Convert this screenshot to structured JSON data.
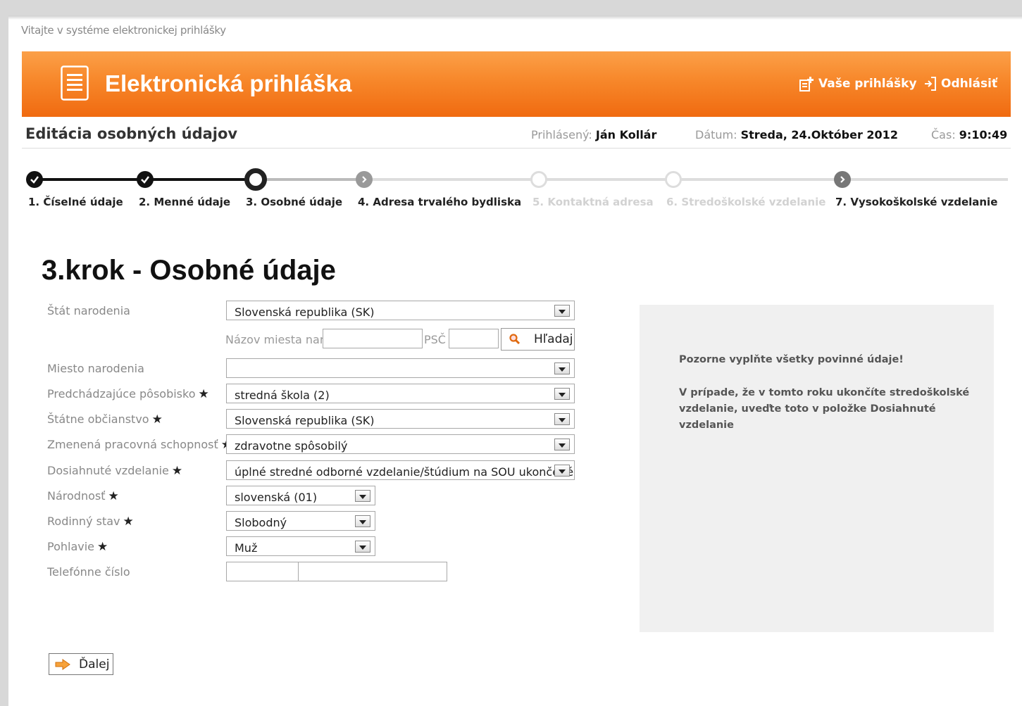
{
  "welcome_text": "Vitajte v systéme elektronickej prihlášky",
  "header": {
    "app_title": "Elektronická prihláška",
    "my_applications_label": "Vaše prihlášky",
    "logout_label": "Odhlásiť",
    "accent_color": "#f7872a"
  },
  "infobar": {
    "page_title": "Editácia osobných údajov",
    "logged_label": "Prihlásený:",
    "logged_user": "Ján Kollár",
    "date_label": "Dátum:",
    "date_value": "Streda, 24.Október 2012",
    "time_label": "Čas:",
    "time_value": "9:10:49"
  },
  "steps": [
    {
      "label": "1. Číselné údaje",
      "state": "done"
    },
    {
      "label": "2. Menné údaje",
      "state": "done"
    },
    {
      "label": "3. Osobné údaje",
      "state": "current"
    },
    {
      "label": "4. Adresa trvalého bydliska",
      "state": "available"
    },
    {
      "label": "5. Kontaktná adresa",
      "state": "disabled"
    },
    {
      "label": "6. Stredoškolské vzdelanie",
      "state": "disabled"
    },
    {
      "label": "7. Vysokoškolské vzdelanie",
      "state": "available"
    }
  ],
  "form": {
    "title": "3.krok - Osobné údaje",
    "required_mark": "★",
    "birth_state_label": "Štát narodenia",
    "birth_state_value": "Slovenská republika (SK)",
    "place_name_placeholder": "Názov miesta nar.",
    "psc_placeholder": "PSČ",
    "search_button_label": "Hľadaj",
    "birth_place_label": "Miesto narodenia",
    "birth_place_value": "",
    "prev_workplace_label": "Predchádzajúce pôsobisko",
    "prev_workplace_value": "stredná škola (2)",
    "citizenship_label": "Štátne občianstvo",
    "citizenship_value": "Slovenská republika (SK)",
    "work_capacity_label": "Zmenená pracovná schopnosť",
    "work_capacity_value": "zdravotne spôsobilý",
    "education_label": "Dosiahnuté vzdelanie",
    "education_value": "úplné stredné odborné vzdelanie/štúdium na SOU ukončené",
    "nationality_label": "Národnosť",
    "nationality_value": "slovenská (01)",
    "marital_label": "Rodinný stav",
    "marital_value": "Slobodný",
    "gender_label": "Pohlavie",
    "gender_value": "Muž",
    "phone_label": "Telefónne číslo",
    "phone_prefix_value": "",
    "phone_number_value": ""
  },
  "infobox": {
    "line1": "Pozorne vyplňte všetky povinné údaje!",
    "line2": "V prípade, že v tomto roku ukončíte stredoškolské vzdelanie, uveďte toto v položke Dosiahnuté vzdelanie"
  },
  "next_button_label": "Ďalej"
}
